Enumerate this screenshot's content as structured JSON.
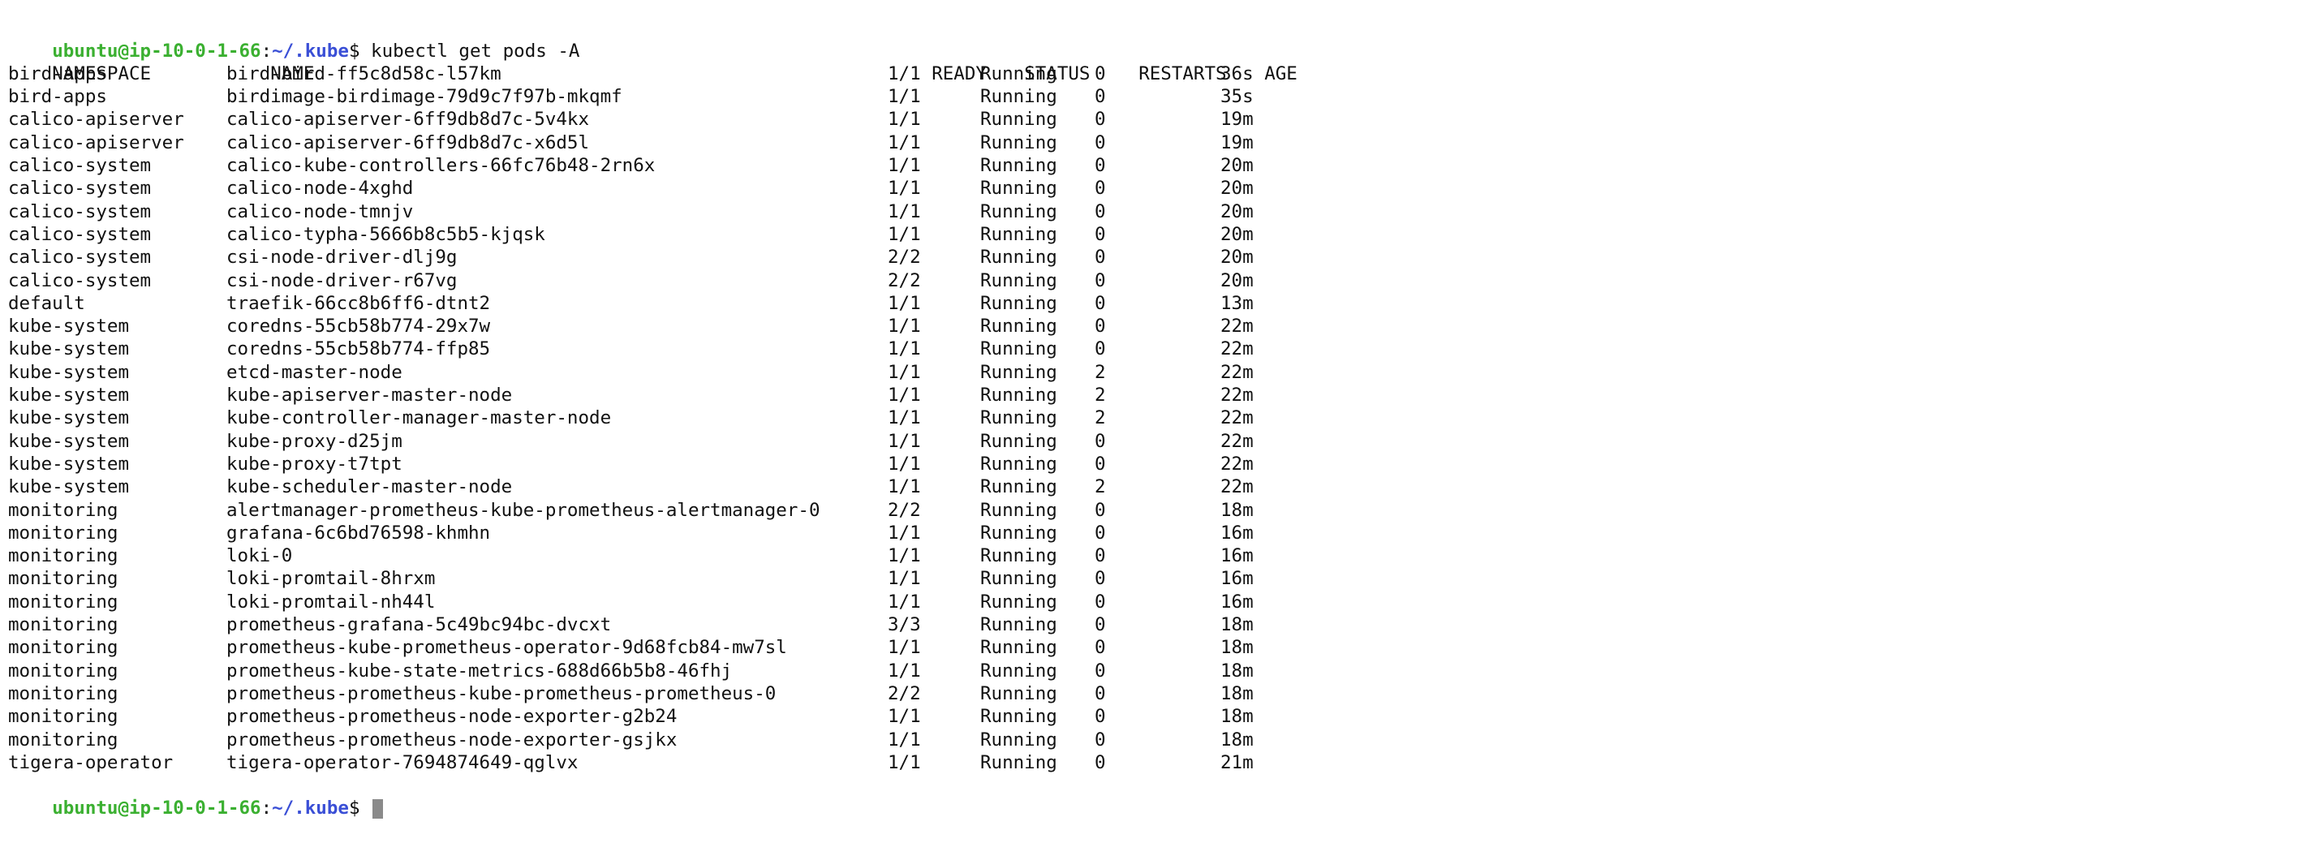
{
  "prompt": {
    "user_host": "ubuntu@ip-10-0-1-66",
    "separator": ":",
    "path": "~/.kube",
    "symbol": "$ ",
    "command": "kubectl get pods -A"
  },
  "table": {
    "headers": [
      "NAMESPACE",
      "NAME",
      "READY",
      "STATUS",
      "RESTARTS",
      "AGE"
    ],
    "rows": [
      {
        "namespace": "bird-apps",
        "name": "bird-bird-ff5c8d58c-l57km",
        "ready": "1/1",
        "status": "Running",
        "restarts": "0",
        "age": "36s"
      },
      {
        "namespace": "bird-apps",
        "name": "birdimage-birdimage-79d9c7f97b-mkqmf",
        "ready": "1/1",
        "status": "Running",
        "restarts": "0",
        "age": "35s"
      },
      {
        "namespace": "calico-apiserver",
        "name": "calico-apiserver-6ff9db8d7c-5v4kx",
        "ready": "1/1",
        "status": "Running",
        "restarts": "0",
        "age": "19m"
      },
      {
        "namespace": "calico-apiserver",
        "name": "calico-apiserver-6ff9db8d7c-x6d5l",
        "ready": "1/1",
        "status": "Running",
        "restarts": "0",
        "age": "19m"
      },
      {
        "namespace": "calico-system",
        "name": "calico-kube-controllers-66fc76b48-2rn6x",
        "ready": "1/1",
        "status": "Running",
        "restarts": "0",
        "age": "20m"
      },
      {
        "namespace": "calico-system",
        "name": "calico-node-4xghd",
        "ready": "1/1",
        "status": "Running",
        "restarts": "0",
        "age": "20m"
      },
      {
        "namespace": "calico-system",
        "name": "calico-node-tmnjv",
        "ready": "1/1",
        "status": "Running",
        "restarts": "0",
        "age": "20m"
      },
      {
        "namespace": "calico-system",
        "name": "calico-typha-5666b8c5b5-kjqsk",
        "ready": "1/1",
        "status": "Running",
        "restarts": "0",
        "age": "20m"
      },
      {
        "namespace": "calico-system",
        "name": "csi-node-driver-dlj9g",
        "ready": "2/2",
        "status": "Running",
        "restarts": "0",
        "age": "20m"
      },
      {
        "namespace": "calico-system",
        "name": "csi-node-driver-r67vg",
        "ready": "2/2",
        "status": "Running",
        "restarts": "0",
        "age": "20m"
      },
      {
        "namespace": "default",
        "name": "traefik-66cc8b6ff6-dtnt2",
        "ready": "1/1",
        "status": "Running",
        "restarts": "0",
        "age": "13m"
      },
      {
        "namespace": "kube-system",
        "name": "coredns-55cb58b774-29x7w",
        "ready": "1/1",
        "status": "Running",
        "restarts": "0",
        "age": "22m"
      },
      {
        "namespace": "kube-system",
        "name": "coredns-55cb58b774-ffp85",
        "ready": "1/1",
        "status": "Running",
        "restarts": "0",
        "age": "22m"
      },
      {
        "namespace": "kube-system",
        "name": "etcd-master-node",
        "ready": "1/1",
        "status": "Running",
        "restarts": "2",
        "age": "22m"
      },
      {
        "namespace": "kube-system",
        "name": "kube-apiserver-master-node",
        "ready": "1/1",
        "status": "Running",
        "restarts": "2",
        "age": "22m"
      },
      {
        "namespace": "kube-system",
        "name": "kube-controller-manager-master-node",
        "ready": "1/1",
        "status": "Running",
        "restarts": "2",
        "age": "22m"
      },
      {
        "namespace": "kube-system",
        "name": "kube-proxy-d25jm",
        "ready": "1/1",
        "status": "Running",
        "restarts": "0",
        "age": "22m"
      },
      {
        "namespace": "kube-system",
        "name": "kube-proxy-t7tpt",
        "ready": "1/1",
        "status": "Running",
        "restarts": "0",
        "age": "22m"
      },
      {
        "namespace": "kube-system",
        "name": "kube-scheduler-master-node",
        "ready": "1/1",
        "status": "Running",
        "restarts": "2",
        "age": "22m"
      },
      {
        "namespace": "monitoring",
        "name": "alertmanager-prometheus-kube-prometheus-alertmanager-0",
        "ready": "2/2",
        "status": "Running",
        "restarts": "0",
        "age": "18m"
      },
      {
        "namespace": "monitoring",
        "name": "grafana-6c6bd76598-khmhn",
        "ready": "1/1",
        "status": "Running",
        "restarts": "0",
        "age": "16m"
      },
      {
        "namespace": "monitoring",
        "name": "loki-0",
        "ready": "1/1",
        "status": "Running",
        "restarts": "0",
        "age": "16m"
      },
      {
        "namespace": "monitoring",
        "name": "loki-promtail-8hrxm",
        "ready": "1/1",
        "status": "Running",
        "restarts": "0",
        "age": "16m"
      },
      {
        "namespace": "monitoring",
        "name": "loki-promtail-nh44l",
        "ready": "1/1",
        "status": "Running",
        "restarts": "0",
        "age": "16m"
      },
      {
        "namespace": "monitoring",
        "name": "prometheus-grafana-5c49bc94bc-dvcxt",
        "ready": "3/3",
        "status": "Running",
        "restarts": "0",
        "age": "18m"
      },
      {
        "namespace": "monitoring",
        "name": "prometheus-kube-prometheus-operator-9d68fcb84-mw7sl",
        "ready": "1/1",
        "status": "Running",
        "restarts": "0",
        "age": "18m"
      },
      {
        "namespace": "monitoring",
        "name": "prometheus-kube-state-metrics-688d66b5b8-46fhj",
        "ready": "1/1",
        "status": "Running",
        "restarts": "0",
        "age": "18m"
      },
      {
        "namespace": "monitoring",
        "name": "prometheus-prometheus-kube-prometheus-prometheus-0",
        "ready": "2/2",
        "status": "Running",
        "restarts": "0",
        "age": "18m"
      },
      {
        "namespace": "monitoring",
        "name": "prometheus-prometheus-node-exporter-g2b24",
        "ready": "1/1",
        "status": "Running",
        "restarts": "0",
        "age": "18m"
      },
      {
        "namespace": "monitoring",
        "name": "prometheus-prometheus-node-exporter-gsjkx",
        "ready": "1/1",
        "status": "Running",
        "restarts": "0",
        "age": "18m"
      },
      {
        "namespace": "tigera-operator",
        "name": "tigera-operator-7694874649-qglvx",
        "ready": "1/1",
        "status": "Running",
        "restarts": "0",
        "age": "21m"
      }
    ]
  },
  "colors": {
    "background": "#ffffff",
    "text": "#111111",
    "prompt_user": "#3bb031",
    "prompt_path": "#3a4fd6",
    "cursor": "#8a8a8a"
  }
}
